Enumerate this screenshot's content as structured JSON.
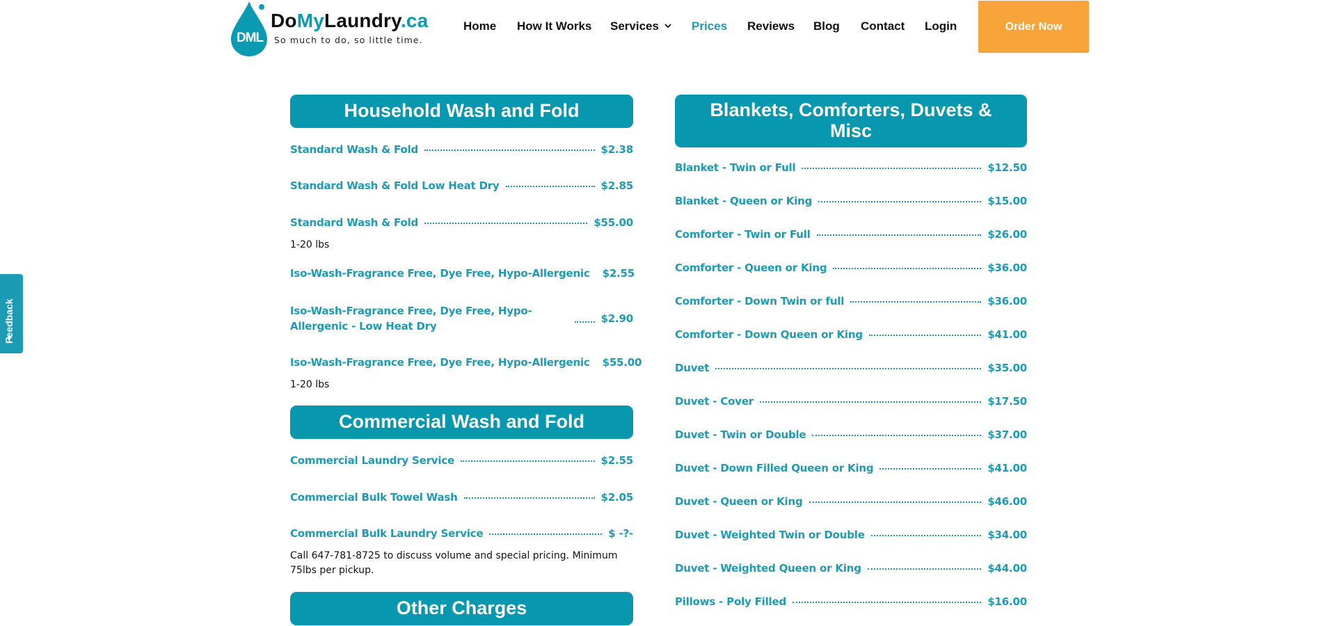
{
  "logo": {
    "drop_text": "DML",
    "name_part1": "Do",
    "name_part2": "My",
    "name_part3": "Laundry",
    "name_part4": ".ca",
    "tagline": "So much to do, so little time."
  },
  "nav": {
    "items": [
      "Home",
      "How It Works",
      "Services",
      "Prices",
      "Reviews",
      "Blog",
      "Contact",
      "Login"
    ],
    "active": "Prices",
    "order_button": "Order Now"
  },
  "feedback": {
    "label": "Feedback"
  },
  "colors": {
    "teal": "#0797ae",
    "text_teal": "#1e9bb4",
    "orange": "#f7a43a"
  },
  "left": {
    "household": {
      "title": "Household Wash and Fold",
      "items": [
        {
          "name": "Standard Wash & Fold",
          "price": "$2.38"
        },
        {
          "name": "Standard Wash & Fold Low Heat Dry",
          "price": "$2.85"
        },
        {
          "name": "Standard Wash & Fold",
          "price": "$55.00",
          "note": "1-20 lbs"
        },
        {
          "name": "Iso-Wash-Fragrance Free, Dye Free, Hypo-Allergenic",
          "price": "$2.55"
        },
        {
          "name": "Iso-Wash-Fragrance Free, Dye Free, Hypo-Allergenic - Low Heat Dry",
          "price": "$2.90"
        },
        {
          "name": "Iso-Wash-Fragrance Free, Dye Free, Hypo-Allergenic",
          "price": "$55.00",
          "note": "1-20 lbs"
        }
      ]
    },
    "commercial": {
      "title": "Commercial Wash and Fold",
      "items": [
        {
          "name": "Commercial Laundry Service",
          "price": "$2.55"
        },
        {
          "name": "Commercial Bulk Towel Wash",
          "price": "$2.05"
        },
        {
          "name": "Commercial Bulk Laundry Service",
          "price": "$ -?-",
          "note": "Call 647-781-8725 to discuss volume and special pricing. Minimum 75lbs per pickup."
        }
      ]
    },
    "other": {
      "title": "Other Charges"
    }
  },
  "right": {
    "blankets": {
      "title": "Blankets, Comforters, Duvets & Misc",
      "items": [
        {
          "name": "Blanket - Twin or Full",
          "price": "$12.50"
        },
        {
          "name": "Blanket - Queen or King",
          "price": "$15.00"
        },
        {
          "name": "Comforter - Twin or Full",
          "price": "$26.00"
        },
        {
          "name": "Comforter - Queen or King",
          "price": "$36.00"
        },
        {
          "name": "Comforter - Down Twin or full",
          "price": "$36.00"
        },
        {
          "name": "Comforter - Down Queen or King",
          "price": "$41.00"
        },
        {
          "name": "Duvet",
          "price": "$35.00"
        },
        {
          "name": "Duvet - Cover",
          "price": "$17.50"
        },
        {
          "name": "Duvet - Twin or Double",
          "price": "$37.00"
        },
        {
          "name": "Duvet - Down Filled Queen or King",
          "price": "$41.00"
        },
        {
          "name": "Duvet - Queen or King",
          "price": "$46.00"
        },
        {
          "name": "Duvet - Weighted Twin or Double",
          "price": "$34.00"
        },
        {
          "name": "Duvet - Weighted Queen or King",
          "price": "$44.00"
        },
        {
          "name": "Pillows - Poly Filled",
          "price": "$16.00"
        }
      ]
    }
  }
}
